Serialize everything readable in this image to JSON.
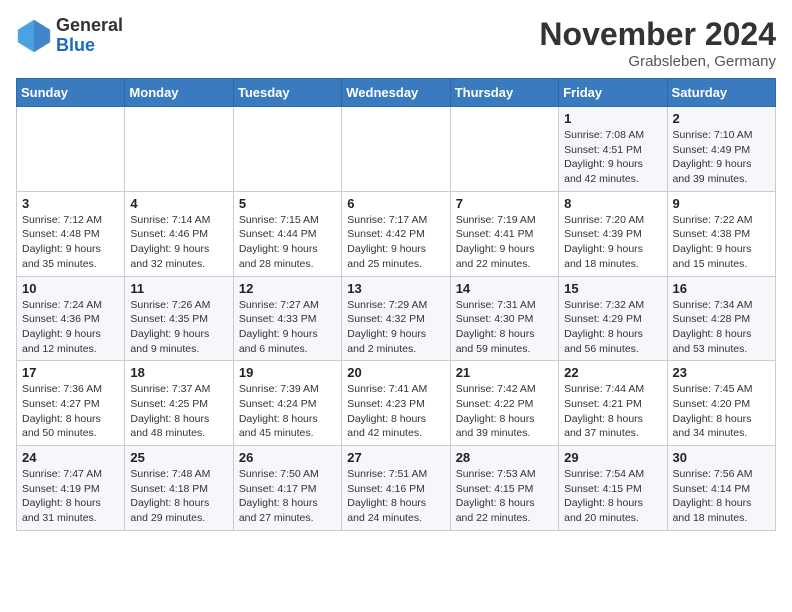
{
  "header": {
    "logo_general": "General",
    "logo_blue": "Blue",
    "month_title": "November 2024",
    "location": "Grabsleben, Germany"
  },
  "days_of_week": [
    "Sunday",
    "Monday",
    "Tuesday",
    "Wednesday",
    "Thursday",
    "Friday",
    "Saturday"
  ],
  "weeks": [
    [
      {
        "day": "",
        "info": ""
      },
      {
        "day": "",
        "info": ""
      },
      {
        "day": "",
        "info": ""
      },
      {
        "day": "",
        "info": ""
      },
      {
        "day": "",
        "info": ""
      },
      {
        "day": "1",
        "info": "Sunrise: 7:08 AM\nSunset: 4:51 PM\nDaylight: 9 hours\nand 42 minutes."
      },
      {
        "day": "2",
        "info": "Sunrise: 7:10 AM\nSunset: 4:49 PM\nDaylight: 9 hours\nand 39 minutes."
      }
    ],
    [
      {
        "day": "3",
        "info": "Sunrise: 7:12 AM\nSunset: 4:48 PM\nDaylight: 9 hours\nand 35 minutes."
      },
      {
        "day": "4",
        "info": "Sunrise: 7:14 AM\nSunset: 4:46 PM\nDaylight: 9 hours\nand 32 minutes."
      },
      {
        "day": "5",
        "info": "Sunrise: 7:15 AM\nSunset: 4:44 PM\nDaylight: 9 hours\nand 28 minutes."
      },
      {
        "day": "6",
        "info": "Sunrise: 7:17 AM\nSunset: 4:42 PM\nDaylight: 9 hours\nand 25 minutes."
      },
      {
        "day": "7",
        "info": "Sunrise: 7:19 AM\nSunset: 4:41 PM\nDaylight: 9 hours\nand 22 minutes."
      },
      {
        "day": "8",
        "info": "Sunrise: 7:20 AM\nSunset: 4:39 PM\nDaylight: 9 hours\nand 18 minutes."
      },
      {
        "day": "9",
        "info": "Sunrise: 7:22 AM\nSunset: 4:38 PM\nDaylight: 9 hours\nand 15 minutes."
      }
    ],
    [
      {
        "day": "10",
        "info": "Sunrise: 7:24 AM\nSunset: 4:36 PM\nDaylight: 9 hours\nand 12 minutes."
      },
      {
        "day": "11",
        "info": "Sunrise: 7:26 AM\nSunset: 4:35 PM\nDaylight: 9 hours\nand 9 minutes."
      },
      {
        "day": "12",
        "info": "Sunrise: 7:27 AM\nSunset: 4:33 PM\nDaylight: 9 hours\nand 6 minutes."
      },
      {
        "day": "13",
        "info": "Sunrise: 7:29 AM\nSunset: 4:32 PM\nDaylight: 9 hours\nand 2 minutes."
      },
      {
        "day": "14",
        "info": "Sunrise: 7:31 AM\nSunset: 4:30 PM\nDaylight: 8 hours\nand 59 minutes."
      },
      {
        "day": "15",
        "info": "Sunrise: 7:32 AM\nSunset: 4:29 PM\nDaylight: 8 hours\nand 56 minutes."
      },
      {
        "day": "16",
        "info": "Sunrise: 7:34 AM\nSunset: 4:28 PM\nDaylight: 8 hours\nand 53 minutes."
      }
    ],
    [
      {
        "day": "17",
        "info": "Sunrise: 7:36 AM\nSunset: 4:27 PM\nDaylight: 8 hours\nand 50 minutes."
      },
      {
        "day": "18",
        "info": "Sunrise: 7:37 AM\nSunset: 4:25 PM\nDaylight: 8 hours\nand 48 minutes."
      },
      {
        "day": "19",
        "info": "Sunrise: 7:39 AM\nSunset: 4:24 PM\nDaylight: 8 hours\nand 45 minutes."
      },
      {
        "day": "20",
        "info": "Sunrise: 7:41 AM\nSunset: 4:23 PM\nDaylight: 8 hours\nand 42 minutes."
      },
      {
        "day": "21",
        "info": "Sunrise: 7:42 AM\nSunset: 4:22 PM\nDaylight: 8 hours\nand 39 minutes."
      },
      {
        "day": "22",
        "info": "Sunrise: 7:44 AM\nSunset: 4:21 PM\nDaylight: 8 hours\nand 37 minutes."
      },
      {
        "day": "23",
        "info": "Sunrise: 7:45 AM\nSunset: 4:20 PM\nDaylight: 8 hours\nand 34 minutes."
      }
    ],
    [
      {
        "day": "24",
        "info": "Sunrise: 7:47 AM\nSunset: 4:19 PM\nDaylight: 8 hours\nand 31 minutes."
      },
      {
        "day": "25",
        "info": "Sunrise: 7:48 AM\nSunset: 4:18 PM\nDaylight: 8 hours\nand 29 minutes."
      },
      {
        "day": "26",
        "info": "Sunrise: 7:50 AM\nSunset: 4:17 PM\nDaylight: 8 hours\nand 27 minutes."
      },
      {
        "day": "27",
        "info": "Sunrise: 7:51 AM\nSunset: 4:16 PM\nDaylight: 8 hours\nand 24 minutes."
      },
      {
        "day": "28",
        "info": "Sunrise: 7:53 AM\nSunset: 4:15 PM\nDaylight: 8 hours\nand 22 minutes."
      },
      {
        "day": "29",
        "info": "Sunrise: 7:54 AM\nSunset: 4:15 PM\nDaylight: 8 hours\nand 20 minutes."
      },
      {
        "day": "30",
        "info": "Sunrise: 7:56 AM\nSunset: 4:14 PM\nDaylight: 8 hours\nand 18 minutes."
      }
    ]
  ]
}
